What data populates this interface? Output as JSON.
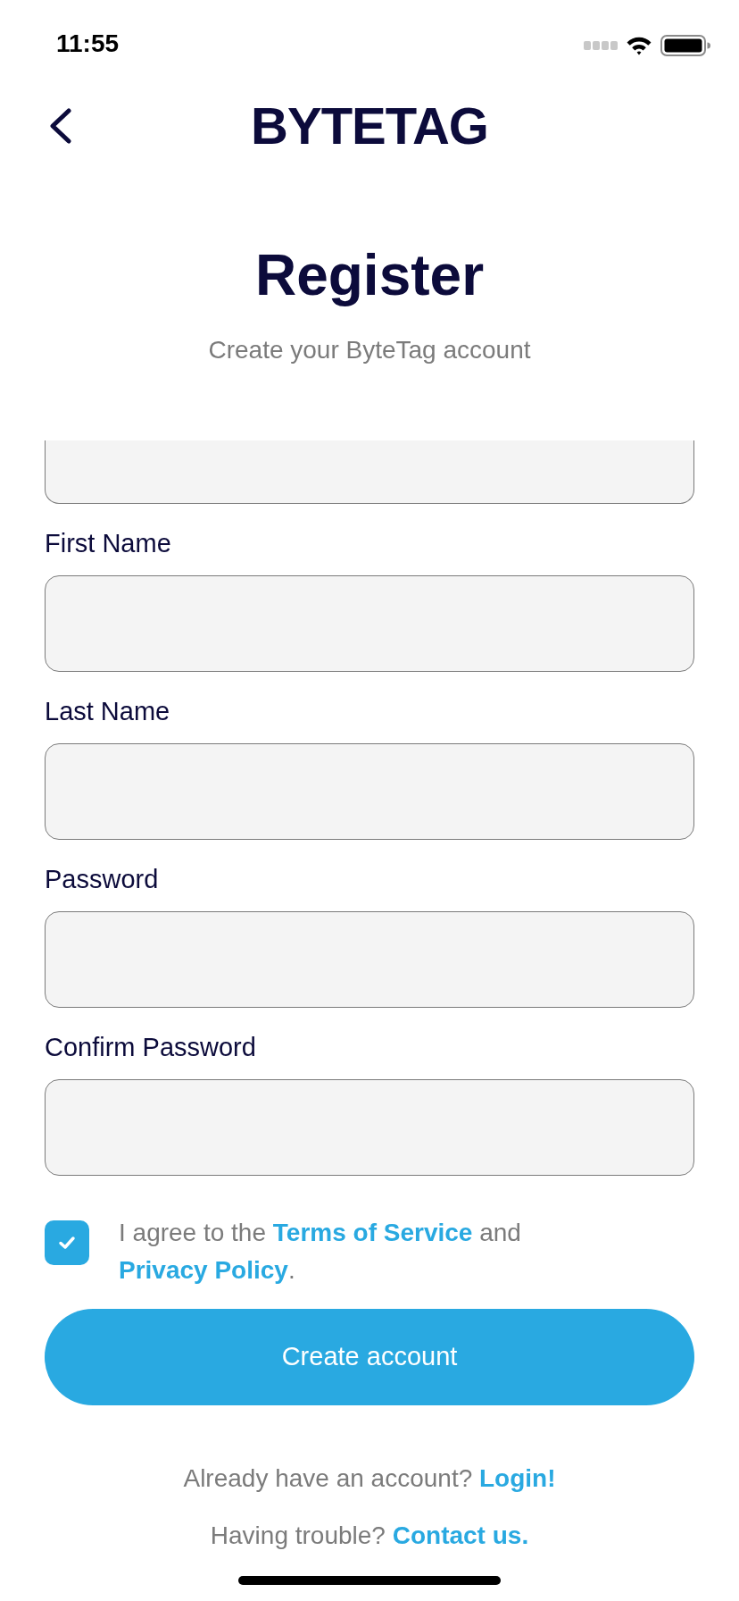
{
  "status_bar": {
    "time": "11:55"
  },
  "header": {
    "logo": "BYTETAG"
  },
  "title": "Register",
  "subtitle": "Create your ByteTag account",
  "fields": [
    {
      "label": "First Name"
    },
    {
      "label": "Last Name"
    },
    {
      "label": "Password"
    },
    {
      "label": "Confirm Password"
    }
  ],
  "agreement": {
    "checked": true,
    "parts": [
      {
        "kind": "text",
        "text": "I agree to the "
      },
      {
        "kind": "link",
        "text": "Terms of Service"
      },
      {
        "kind": "text",
        "text": " and "
      },
      {
        "kind": "link",
        "text": "Privacy Policy"
      },
      {
        "kind": "text",
        "text": "."
      }
    ]
  },
  "submit_button": {
    "label": "Create account"
  },
  "footer": [
    {
      "text": "Already have an account?",
      "link": "Login!"
    },
    {
      "text": "Having trouble?",
      "link": "Contact us."
    }
  ]
}
